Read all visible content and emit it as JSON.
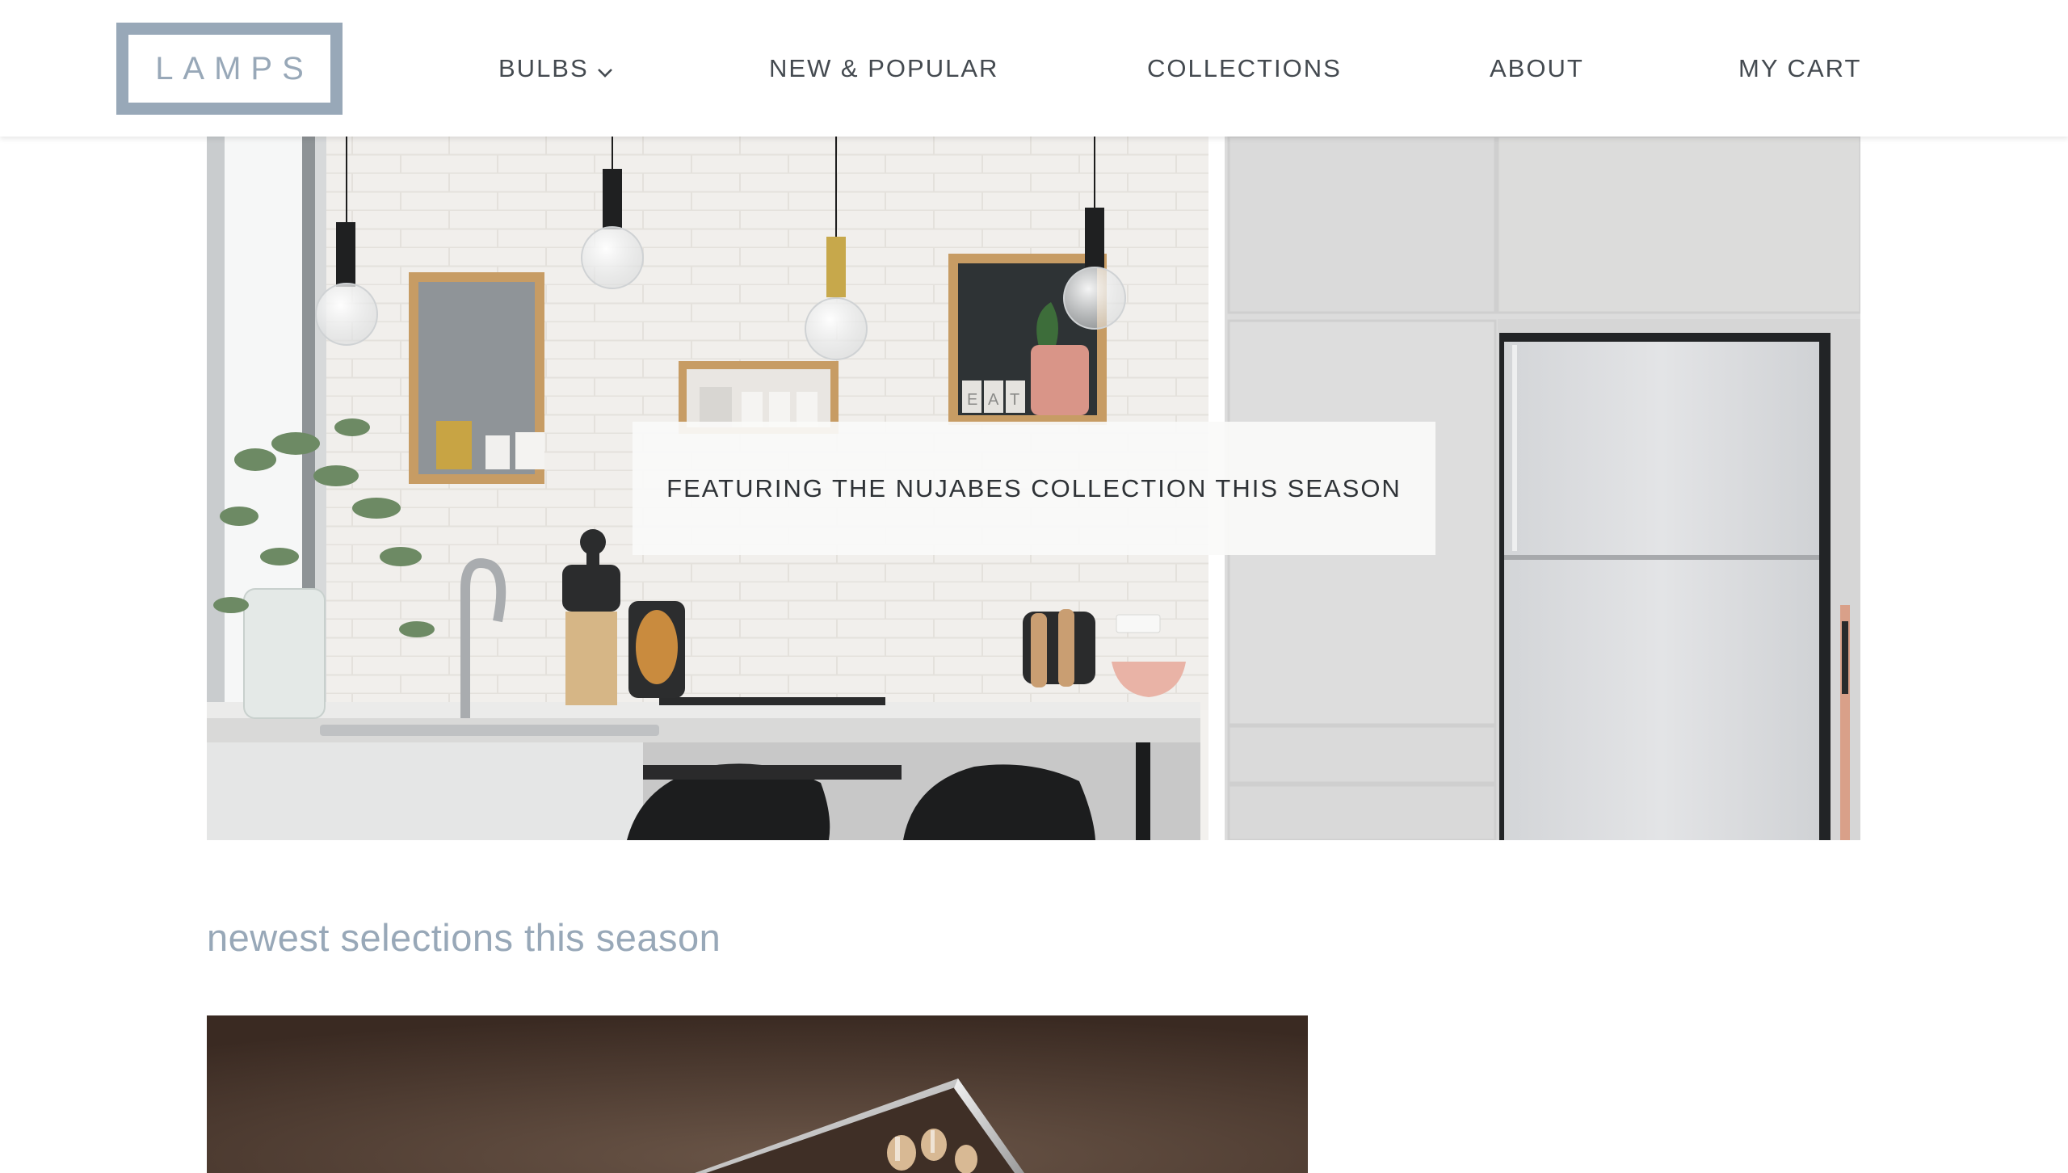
{
  "header": {
    "logo": "LAMPS",
    "nav": [
      {
        "label": "BULBS",
        "has_dropdown": true
      },
      {
        "label": "NEW & POPULAR"
      },
      {
        "label": "COLLECTIONS"
      },
      {
        "label": "ABOUT"
      },
      {
        "label": "MY CART"
      }
    ]
  },
  "hero": {
    "banner_text": "FEATURING THE NUJABES COLLECTION THIS SEASON",
    "jar_letters": [
      "E",
      "A",
      "T"
    ]
  },
  "section": {
    "title": "newest selections this season"
  },
  "colors": {
    "accent": "#98a8b8",
    "nav_text": "#444a50",
    "banner_text": "#2e3236"
  }
}
